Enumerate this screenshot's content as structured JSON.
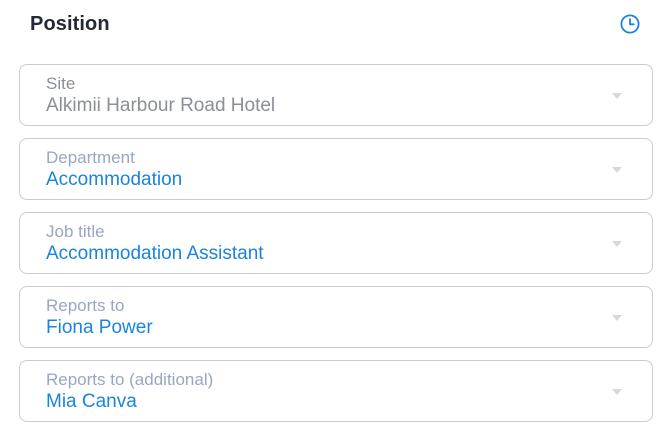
{
  "section": {
    "title": "Position",
    "history_icon": "clock-icon",
    "accent_color": "#1a84dc"
  },
  "fields": [
    {
      "label": "Site",
      "value": "Alkimii Harbour Road Hotel",
      "state": "readonly"
    },
    {
      "label": "Department",
      "value": "Accommodation",
      "state": "editable"
    },
    {
      "label": "Job title",
      "value": "Accommodation Assistant",
      "state": "editable"
    },
    {
      "label": "Reports to",
      "value": "Fiona Power",
      "state": "editable"
    },
    {
      "label": "Reports to (additional)",
      "value": "Mia Canva",
      "state": "editable"
    }
  ]
}
